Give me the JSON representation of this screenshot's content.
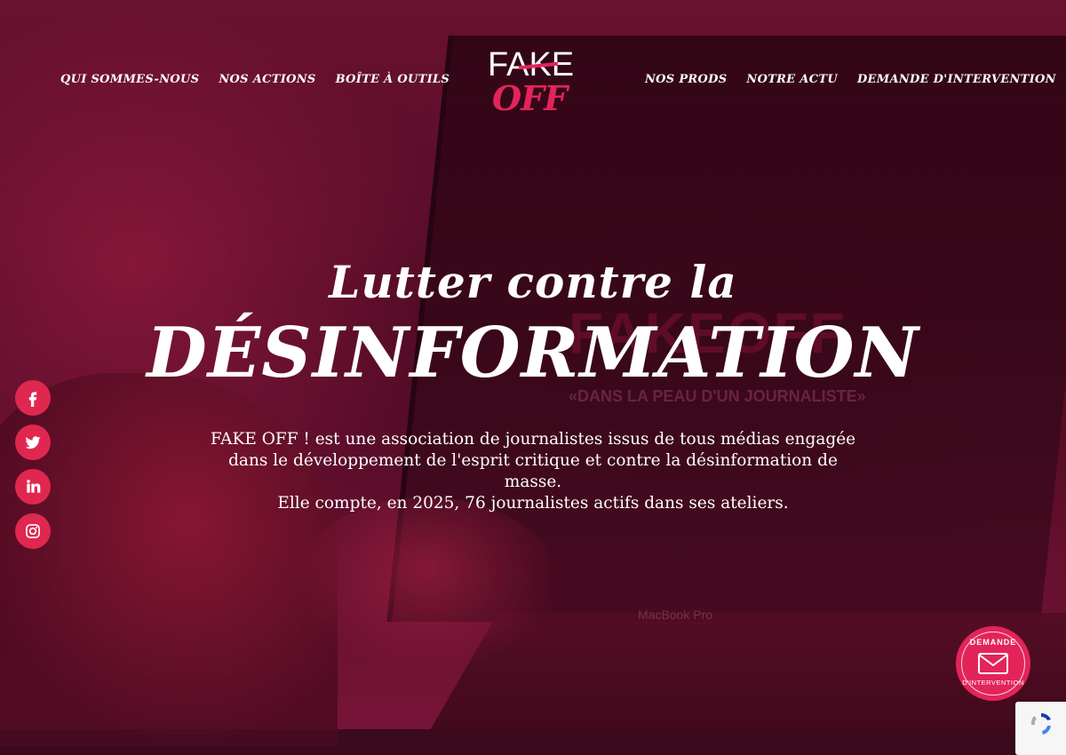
{
  "nav_left": [
    {
      "label": "QUI SOMMES-NOUS"
    },
    {
      "label": "NOS ACTIONS"
    },
    {
      "label": "BOÎTE À OUTILS"
    }
  ],
  "nav_right": [
    {
      "label": "NOS PRODS"
    },
    {
      "label": "NOTRE ACTU"
    },
    {
      "label": "DEMANDE D'INTERVENTION"
    }
  ],
  "logo": {
    "top": "FAKE",
    "bottom": "OFF"
  },
  "hero": {
    "line1": "Lutter contre la",
    "line2": "DÉSINFORMATION",
    "paragraph1": "FAKE OFF ! est une association de journalistes issus de tous médias engagée dans le développement de l'esprit critique et contre la désinformation de masse.",
    "paragraph2": "Elle compte, en 2025, 76 journalistes actifs dans ses ateliers."
  },
  "social": [
    {
      "icon": "facebook-icon"
    },
    {
      "icon": "twitter-icon"
    },
    {
      "icon": "linkedin-icon"
    },
    {
      "icon": "instagram-icon"
    }
  ],
  "badge": {
    "top": "DEMANDE",
    "bottom": "D'INTERVENTION"
  },
  "background": {
    "screen_logo": "FAKEOFF",
    "screen_tagline": "«DANS LA PEAU D'UN JOURNALISTE»",
    "laptop_brand": "MacBook Pro"
  },
  "colors": {
    "accent": "#e3245a",
    "social": "#e0274f"
  }
}
